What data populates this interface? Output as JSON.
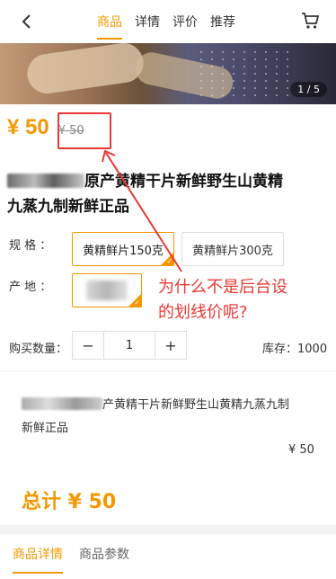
{
  "header": {
    "back_icon": "chevron-left-icon",
    "tabs": [
      {
        "label": "商品",
        "active": true
      },
      {
        "label": "详情",
        "active": false
      },
      {
        "label": "评价",
        "active": false
      },
      {
        "label": "推荐",
        "active": false
      }
    ],
    "cart_icon": "cart-icon"
  },
  "gallery": {
    "pager": "1 / 5"
  },
  "price": {
    "current": "¥ 50",
    "original": "¥ 50"
  },
  "product": {
    "title_line1": "原产黄精干片新鲜野生山黄精",
    "title_line2": "九蒸九制新鲜正品"
  },
  "spec": {
    "label": "规  格 ：",
    "options": [
      {
        "label": "黄精鲜片150克",
        "selected": true
      },
      {
        "label": "黄精鲜片300克",
        "selected": false
      }
    ]
  },
  "origin": {
    "label": "产  地 ："
  },
  "annotation": {
    "text_line1": "为什么不是后台设",
    "text_line2": "的划线价呢?"
  },
  "quantity": {
    "label": "购买数量：",
    "minus": "−",
    "value": "1",
    "plus": "+"
  },
  "stock": {
    "text": "库存：1000"
  },
  "summary": {
    "line1": "产黄精干片新鲜野生山黄精九蒸九制",
    "line2": "新鲜正品",
    "price": "¥ 50",
    "total": "总计 ¥ 50"
  },
  "bottom_tabs": [
    {
      "label": "商品详情",
      "active": true
    },
    {
      "label": "商品参数",
      "active": false
    }
  ],
  "colors": {
    "accent": "#f39800",
    "annotation": "#e53935"
  }
}
